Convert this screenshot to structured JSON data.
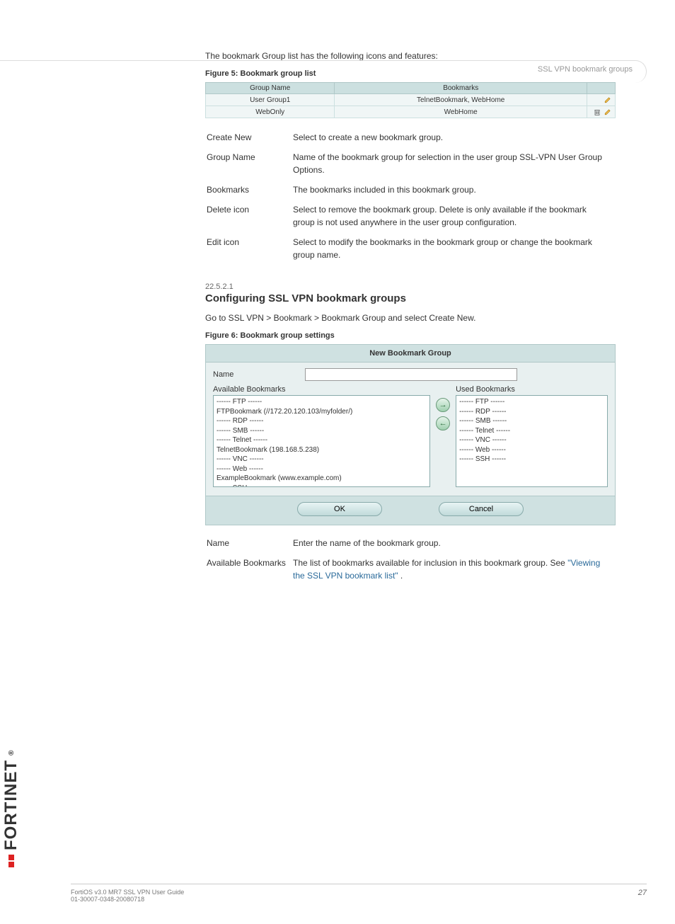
{
  "header_right": "SSL VPN bookmark groups",
  "intro": {
    "bp1": "The bookmark Group list has the following icons and features:",
    "fig5": "Figure 5: Bookmark group list"
  },
  "bookmark_table": {
    "headers": {
      "group": "Group Name",
      "bookmarks": "Bookmarks"
    },
    "rows": [
      {
        "group": "User Group1",
        "bookmarks": "TelnetBookmark, WebHome",
        "delete": false
      },
      {
        "group": "WebOnly",
        "bookmarks": "WebHome",
        "delete": true
      }
    ]
  },
  "defs1": {
    "create": {
      "term": "Create New",
      "desc": "Select to create a new bookmark group."
    },
    "gname": {
      "term": "Group Name",
      "desc": "Name of the bookmark group for selection in the user group SSL-VPN User Group Options."
    },
    "bmarks": {
      "term": "Bookmarks",
      "desc": "The bookmarks included in this bookmark group."
    },
    "delicon": {
      "term": "Delete icon",
      "desc": "Select to remove the bookmark group. Delete is only available if the bookmark group is not used anywhere in the user group configuration."
    },
    "editicon": {
      "term": "Edit icon",
      "desc": "Select to modify the bookmarks in the bookmark group or change the bookmark group name."
    }
  },
  "section": {
    "num": "22.5.2.1",
    "title": "Configuring SSL VPN bookmark groups",
    "nav": "Go to SSL VPN > Bookmark > Bookmark Group and select Create New.",
    "fig6": "Figure 6: Bookmark group settings"
  },
  "dialog": {
    "title": "New Bookmark Group",
    "name_label": "Name",
    "name_value": "",
    "available_label": "Available Bookmarks",
    "used_label": "Used Bookmarks",
    "available": [
      "------ FTP ------",
      "FTPBookmark (//172.20.120.103/myfolder/)",
      "------ RDP ------",
      "------ SMB ------",
      "------ Telnet ------",
      "TelnetBookmark (198.168.5.238)",
      "------ VNC ------",
      "------ Web ------",
      "ExampleBookmark (www.example.com)",
      "------ SSH ------"
    ],
    "used": [
      "------ FTP ------",
      "------ RDP ------",
      "------ SMB ------",
      "------ Telnet ------",
      "------ VNC ------",
      "------ Web ------",
      "------ SSH ------"
    ],
    "ok": "OK",
    "cancel": "Cancel"
  },
  "defs2": {
    "name": {
      "term": "Name",
      "desc": "Enter the name of the bookmark group."
    },
    "avail": {
      "term": "Available Bookmarks",
      "desc_before": "The list of bookmarks available for inclusion in this bookmark group. See ",
      "link": "\"Viewing the SSL VPN bookmark list\"",
      "desc_after": "."
    }
  },
  "footer": {
    "left": "FortiOS v3.0 MR7 SSL VPN User Guide",
    "right_top": "",
    "right_bottom": "01-30007-0348-20080718",
    "page": "27"
  },
  "brand": "FORTINET",
  "brand_reg": "®"
}
